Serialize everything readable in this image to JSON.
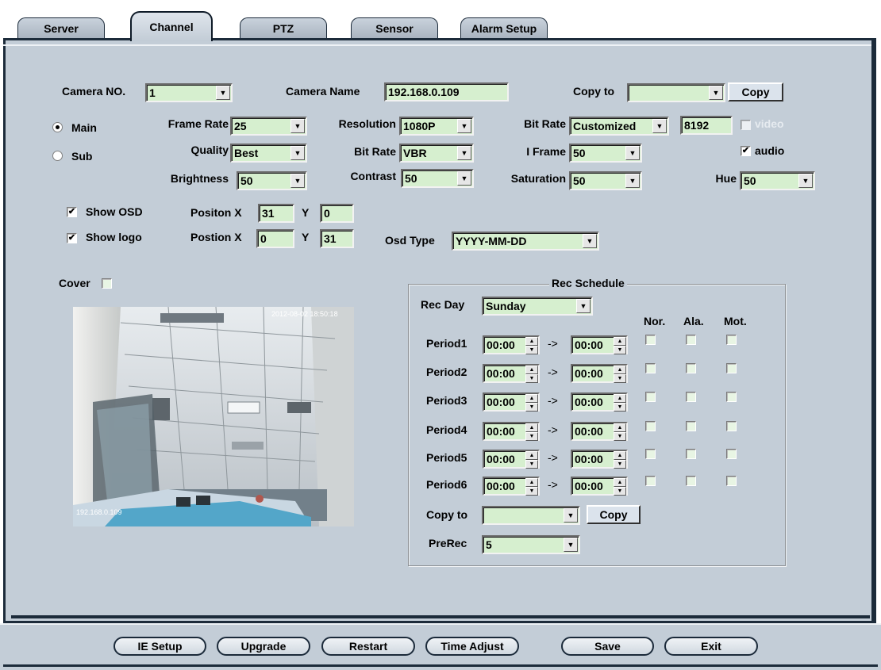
{
  "tabs": [
    {
      "label": "Server"
    },
    {
      "label": "Channel"
    },
    {
      "label": "PTZ"
    },
    {
      "label": "Sensor"
    },
    {
      "label": "Alarm Setup"
    }
  ],
  "camera": {
    "no_label": "Camera NO.",
    "no_value": "1",
    "name_label": "Camera Name",
    "name_value": "192.168.0.109",
    "copy_to_label": "Copy to",
    "copy_to_value": "",
    "copy_button": "Copy"
  },
  "stream": {
    "main_label": "Main",
    "sub_label": "Sub",
    "selected": "Main"
  },
  "video_settings": {
    "frame_rate_label": "Frame Rate",
    "frame_rate": "25",
    "resolution_label": "Resolution",
    "resolution": "1080P",
    "bitrate_label": "Bit Rate",
    "bitrate": "Customized",
    "bitrate_value": "8192",
    "video_label": "video",
    "video_checked": false,
    "video_enabled": false,
    "quality_label": "Quality",
    "quality": "Best",
    "bitrate_type_label": "Bit Rate",
    "bitrate_type": "VBR",
    "iframe_label": "I Frame",
    "iframe": "50",
    "audio_label": "audio",
    "audio_checked": true,
    "brightness_label": "Brightness",
    "brightness": "50",
    "contrast_label": "Contrast",
    "contrast": "50",
    "saturation_label": "Saturation",
    "saturation": "50",
    "hue_label": "Hue",
    "hue": "50"
  },
  "osd": {
    "show_osd_label": "Show OSD",
    "show_osd_checked": true,
    "osd_pos_x_label": "Positon X",
    "osd_x": "31",
    "osd_y_label": "Y",
    "osd_y": "0",
    "show_logo_label": "Show logo",
    "show_logo_checked": true,
    "logo_pos_x_label": "Postion X",
    "logo_x": "0",
    "logo_y_label": "Y",
    "logo_y": "31",
    "osd_type_label": "Osd Type",
    "osd_type": "YYYY-MM-DD"
  },
  "cover": {
    "label": "Cover",
    "checked": false
  },
  "preview": {
    "timestamp": "2012-08-02 18:50:18",
    "ip": "192.168.0.109"
  },
  "schedule": {
    "title": "Rec Schedule",
    "rec_day_label": "Rec Day",
    "rec_day": "Sunday",
    "col_nor": "Nor.",
    "col_ala": "Ala.",
    "col_mot": "Mot.",
    "arrow": "->",
    "periods": [
      {
        "label": "Period1",
        "start": "00:00",
        "end": "00:00"
      },
      {
        "label": "Period2",
        "start": "00:00",
        "end": "00:00"
      },
      {
        "label": "Period3",
        "start": "00:00",
        "end": "00:00"
      },
      {
        "label": "Period4",
        "start": "00:00",
        "end": "00:00"
      },
      {
        "label": "Period5",
        "start": "00:00",
        "end": "00:00"
      },
      {
        "label": "Period6",
        "start": "00:00",
        "end": "00:00"
      }
    ],
    "copy_to_label": "Copy to",
    "copy_to_value": "",
    "copy_button": "Copy",
    "prerec_label": "PreRec",
    "prerec": "5"
  },
  "footer": {
    "ie_setup": "IE Setup",
    "upgrade": "Upgrade",
    "restart": "Restart",
    "time_adjust": "Time Adjust",
    "save": "Save",
    "exit": "Exit"
  },
  "colors": {
    "panel_bg": "#c3cdd7",
    "field_bg": "#d6efcf",
    "border_dark": "#1c2b3a"
  },
  "icons": [
    "dropdown-arrow-icon",
    "spin-up-icon",
    "spin-down-icon",
    "checkmark-icon"
  ]
}
